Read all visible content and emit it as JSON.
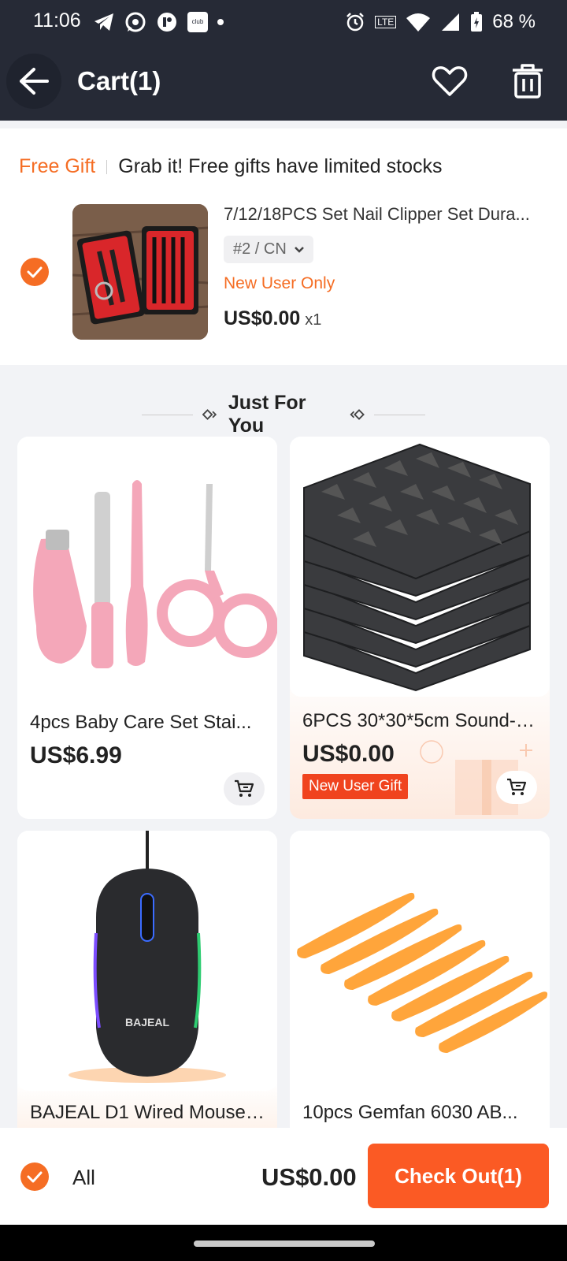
{
  "status_bar": {
    "time": "11:06",
    "club_text": "club",
    "lte_text": "LTE",
    "battery": "68 %"
  },
  "header": {
    "title": "Cart(1)"
  },
  "free_gift": {
    "tag": "Free Gift",
    "message": "Grab it! Free gifts have limited stocks",
    "item": {
      "name": "7/12/18PCS Set Nail Clipper Set Dura...",
      "sku": "#2 / CN",
      "badge": "New User Only",
      "price": "US$0.00",
      "quantity": "x1",
      "selected": true
    }
  },
  "recommendations": {
    "title": "Just For You",
    "items": [
      {
        "name": "4pcs Baby Care Set Stai...",
        "price": "US$6.99",
        "badge": ""
      },
      {
        "name": "6PCS 30*30*5cm Sound-a...",
        "price": "US$0.00",
        "badge": "New User Gift"
      },
      {
        "name": "BAJEAL D1 Wired Mouse 4...",
        "price": "",
        "badge": "",
        "brand": "BAJEAL"
      },
      {
        "name": "10pcs Gemfan 6030 AB...",
        "price": "",
        "badge": ""
      }
    ]
  },
  "bottom_bar": {
    "select_all_label": "All",
    "total": "US$0.00",
    "checkout_label": "Check Out(1)"
  },
  "colors": {
    "accent": "#f56d24",
    "checkout": "#fb5a24",
    "header_bg": "#262a36",
    "gift_badge": "#f0431e"
  }
}
